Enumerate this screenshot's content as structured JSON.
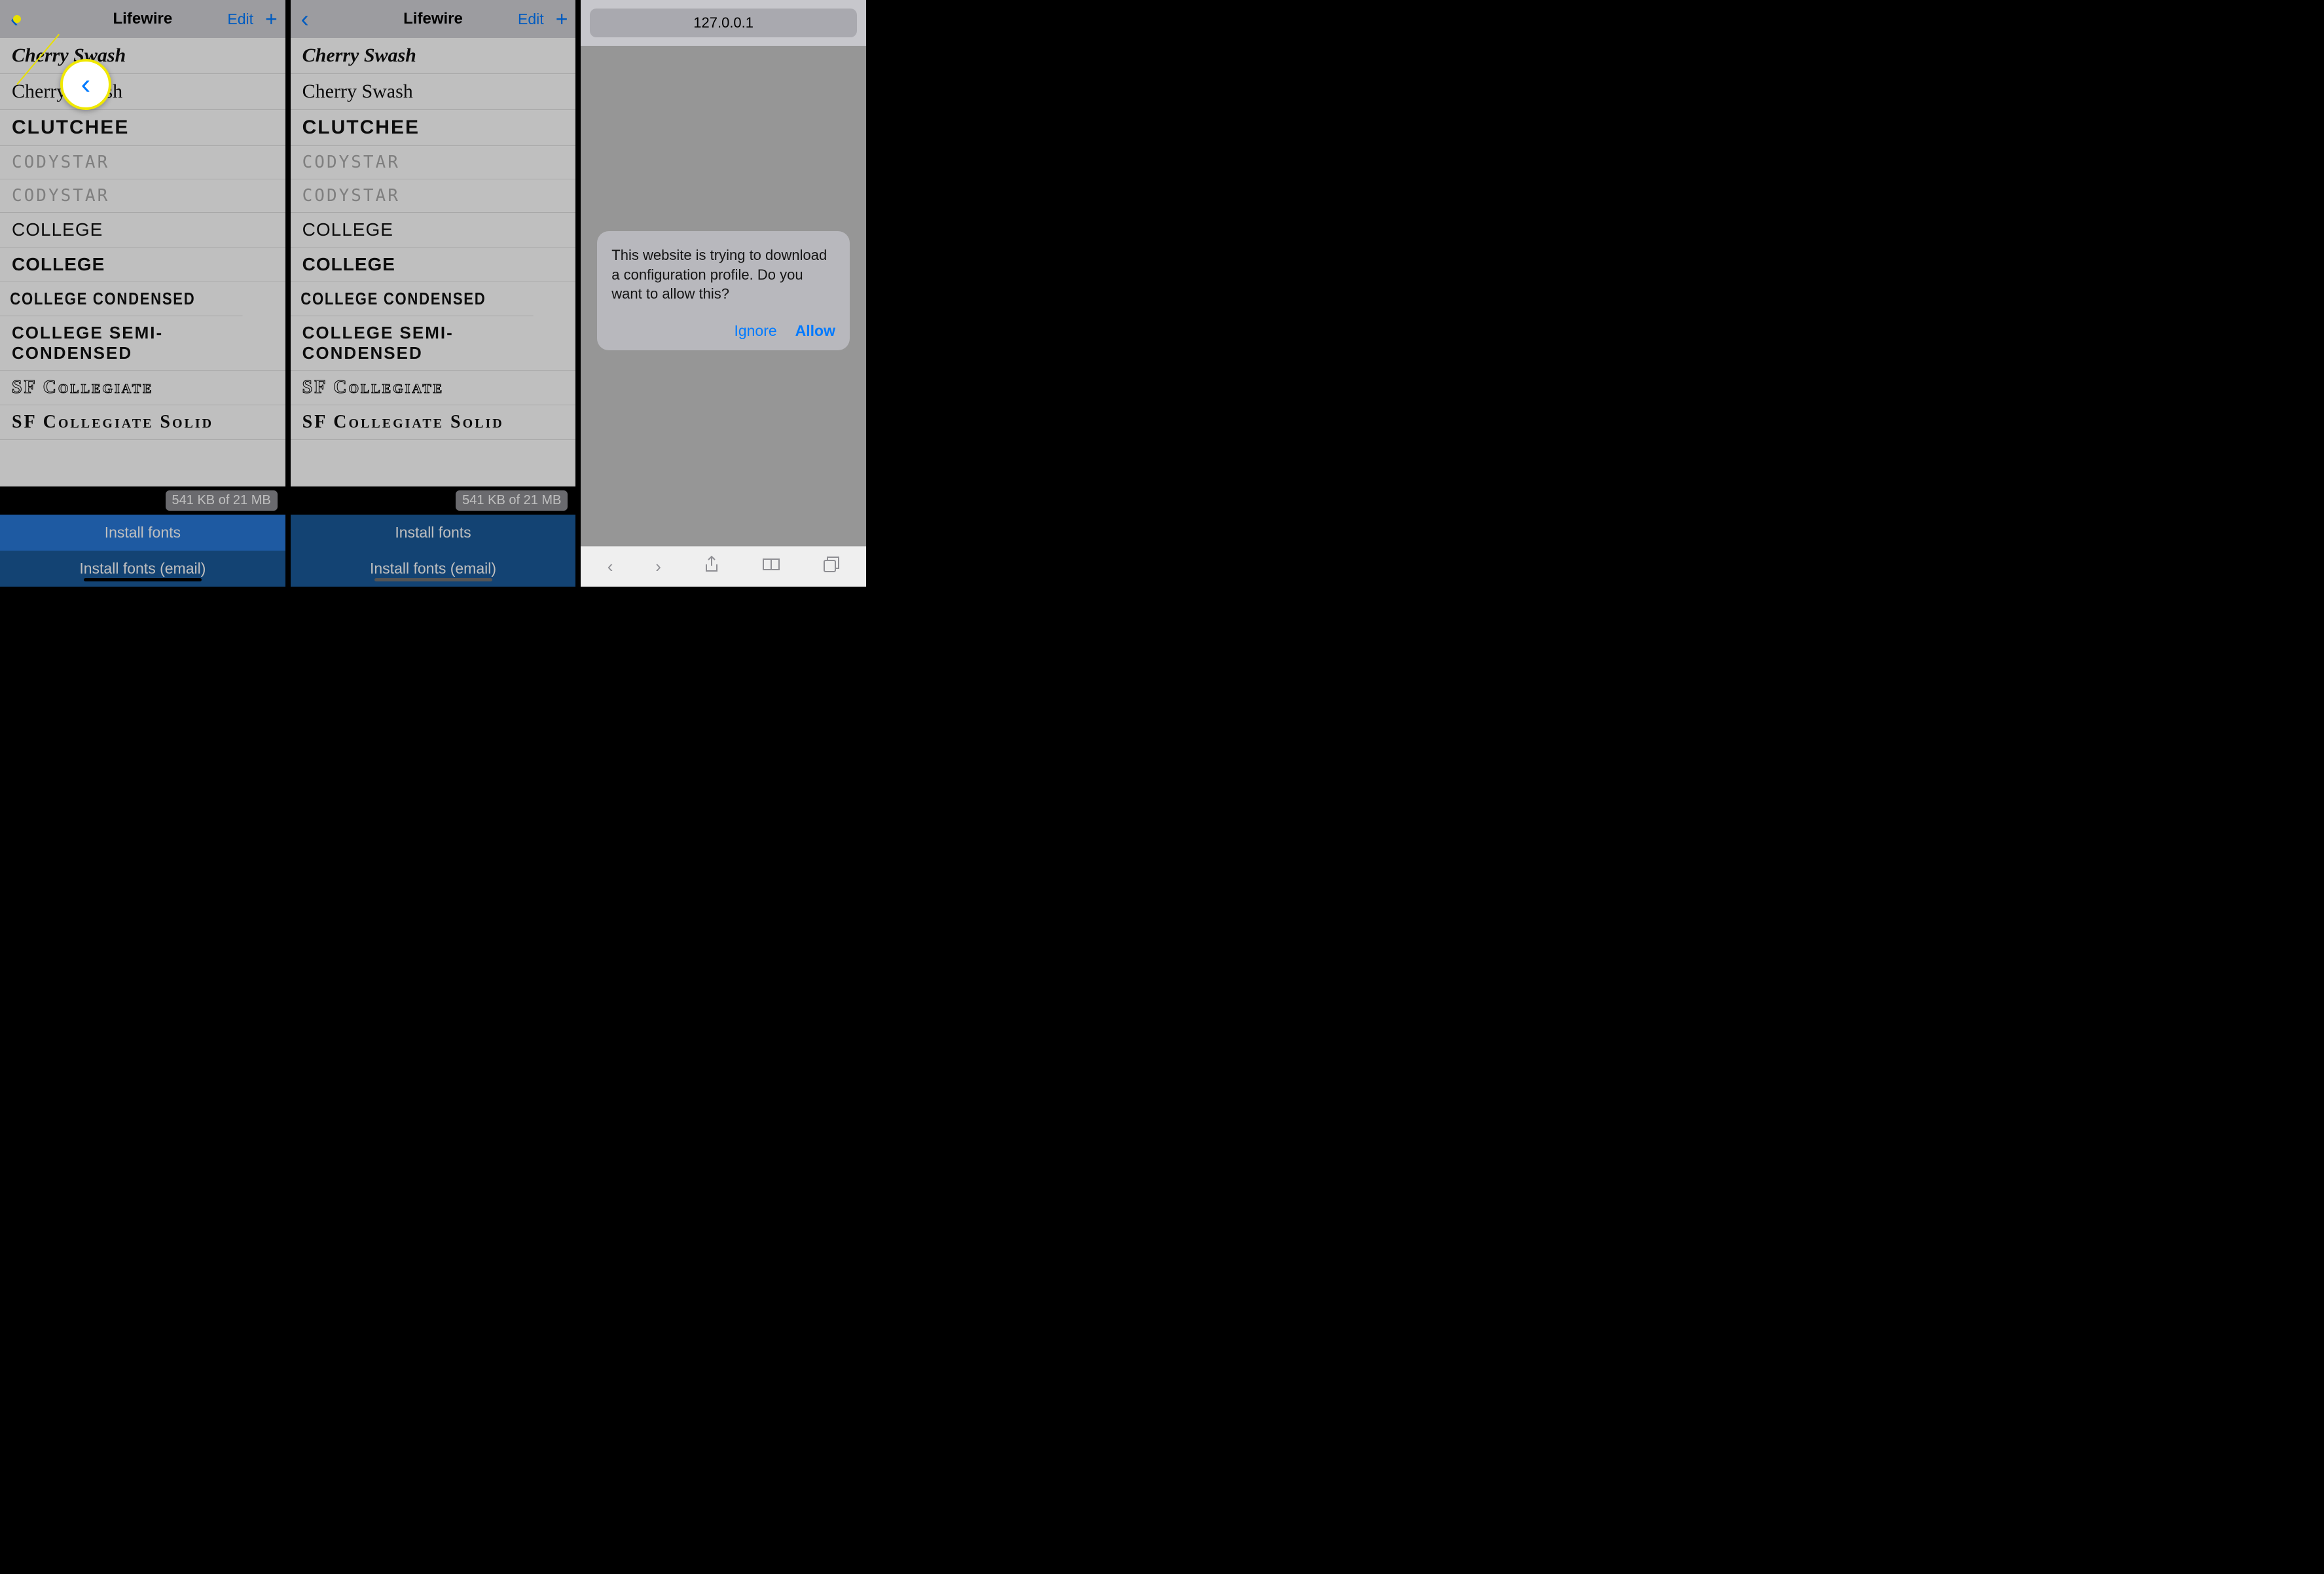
{
  "shared": {
    "title": "Lifewire",
    "edit": "Edit",
    "fonts": [
      {
        "name": "Cherry Swash",
        "cls": "f-cherry1"
      },
      {
        "name": "Cherry Swash",
        "cls": "f-cherry2"
      },
      {
        "name": "CLUTCHEE",
        "cls": "f-clutchee"
      },
      {
        "name": "CODYSTAR",
        "cls": "f-codystar"
      },
      {
        "name": "CODYSTAR",
        "cls": "f-codystar"
      },
      {
        "name": "COLLEGE",
        "cls": "f-college1"
      },
      {
        "name": "COLLEGE",
        "cls": "f-college2"
      },
      {
        "name": "COLLEGE CONDENSED",
        "cls": "f-collegecond"
      },
      {
        "name": "COLLEGE SEMI-CONDENSED",
        "cls": "f-collegesemi"
      },
      {
        "name": "SF Collegiate",
        "cls": "f-sfcoll"
      },
      {
        "name": "SF Collegiate Solid",
        "cls": "f-sfcollsolid"
      }
    ],
    "size_info": "541 KB of 21 MB",
    "install_fonts": "Install fonts",
    "install_email": "Install fonts (email)"
  },
  "safari": {
    "url": "127.0.0.1",
    "alert_msg": "This website is trying to download a configuration profile. Do you want to allow this?",
    "ignore": "Ignore",
    "allow": "Allow"
  },
  "callouts": {
    "install_preview": "Install fonts",
    "install_preview2": "fonts",
    "allow_preview": "Allow"
  }
}
